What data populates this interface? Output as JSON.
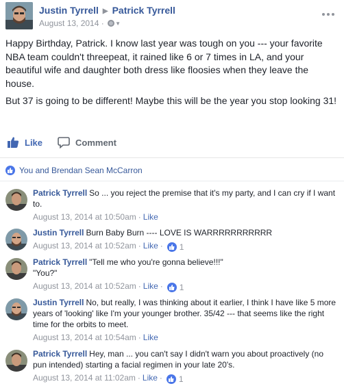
{
  "post": {
    "author": "Justin Tyrrell",
    "recipient": "Patrick Tyrrell",
    "date": "August 13, 2014",
    "dot": "·",
    "paragraphs": [
      "Happy Birthday, Patrick. I know last year was tough on you --- your favorite NBA team couldn't threepeat, it rained like 6 or 7 times in LA, and your beautiful wife and daughter both dress like floosies when they leave the house.",
      "But 37 is going to be different! Maybe this will be the year you stop looking 31!"
    ]
  },
  "actions": {
    "like_label": "Like",
    "comment_label": "Comment"
  },
  "reactions": {
    "summary": "You and Brendan Sean McCarron"
  },
  "comments": [
    {
      "author": "Patrick Tyrrell",
      "text": "So ... you reject the premise that it's my party, and I can cry if I want to.",
      "time": "August 13, 2014 at 10:50am",
      "like_label": "Like",
      "likes": ""
    },
    {
      "author": "Justin Tyrrell",
      "text": "Burn Baby Burn ---- LOVE IS WARRRRRRRRRRR",
      "time": "August 13, 2014 at 10:52am",
      "like_label": "Like",
      "likes": "1"
    },
    {
      "author": "Patrick Tyrrell",
      "text_lines": [
        "\"Tell me who you're gonna believe!!!\"",
        "\"You?\""
      ],
      "time": "August 13, 2014 at 10:52am",
      "like_label": "Like",
      "likes": "1"
    },
    {
      "author": "Justin Tyrrell",
      "text": "No, but really, I was thinking about it earlier, I think I have like 5 more years of 'looking' like I'm your younger brother. 35/42 --- that seems like the right time for the orbits to meet.",
      "time": "August 13, 2014 at 10:54am",
      "like_label": "Like",
      "likes": ""
    },
    {
      "author": "Patrick Tyrrell",
      "text": "Hey, man ... you can't say I didn't warn you about proactively (no pun intended) starting a facial regimen in your late 20's.",
      "time": "August 13, 2014 at 11:02am",
      "like_label": "Like",
      "likes": "1"
    }
  ],
  "colors": {
    "link": "#365899",
    "action": "#4267b2",
    "meta": "#90949c",
    "text": "#1d2129",
    "like_badge": "#4a76e8"
  }
}
